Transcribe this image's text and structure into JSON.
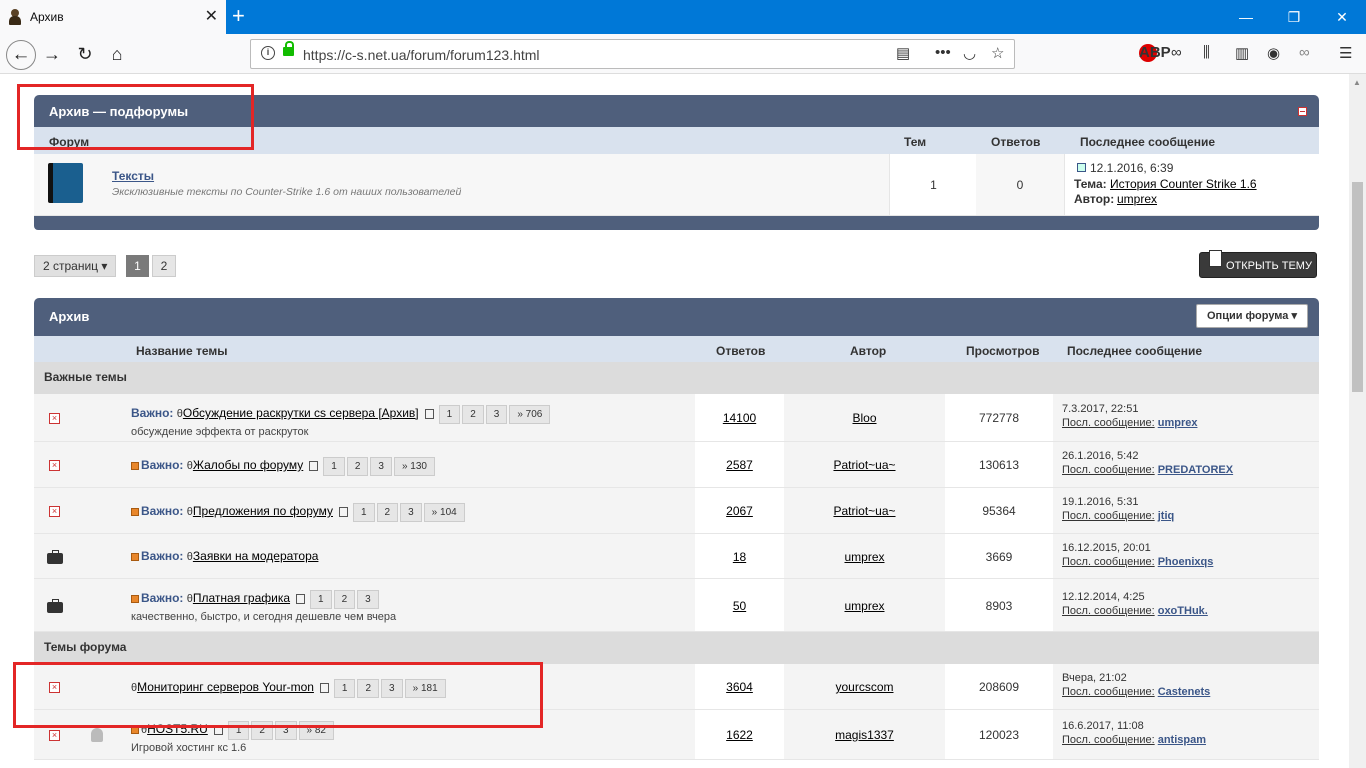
{
  "browser": {
    "tab_title": "Архив",
    "url": "https://c-s.net.ua/forum/forum123.html"
  },
  "subforums": {
    "title": "Архив — подфорумы",
    "headers": {
      "forum": "Форум",
      "topics": "Тем",
      "replies": "Ответов",
      "last": "Последнее сообщение"
    },
    "row": {
      "name": "Тексты",
      "desc": "Эксклюзивные тексты по Counter-Strike 1.6 от наших пользователей",
      "topics": "1",
      "replies": "0",
      "last_date": "12.1.2016, 6:39",
      "topic_label": "Тема:",
      "topic_link": "История Counter Strike 1.6",
      "author_label": "Автор:",
      "author_link": "umprex"
    }
  },
  "pagination": {
    "pages_label": "2 страниц",
    "p1": "1",
    "p2": "2"
  },
  "open_topic_label": "ОТКРЫТЬ ТЕМУ",
  "archive": {
    "title": "Архив",
    "options_label": "Опции форума",
    "headers": {
      "name": "Название темы",
      "replies": "Ответов",
      "author": "Автор",
      "views": "Просмотров",
      "last": "Последнее сообщение"
    },
    "section_important": "Важные темы",
    "section_forum": "Темы форума",
    "imp_label": "Важно:",
    "last_label": "Посл. сообщение:",
    "rows": [
      {
        "title": "Обсуждение раскрутки cs сервера [Архив]",
        "desc": "обсуждение эффекта от раскруток",
        "pages": [
          "1",
          "2",
          "3",
          "» 706"
        ],
        "replies": "14100",
        "author": "Bloo",
        "views": "772778",
        "date": "7.3.2017, 22:51",
        "last_user": "umprex"
      },
      {
        "title": "Жалобы по форуму",
        "desc": "",
        "pages": [
          "1",
          "2",
          "3",
          "» 130"
        ],
        "replies": "2587",
        "author": "Patriot~ua~",
        "views": "130613",
        "date": "26.1.2016, 5:42",
        "last_user": "PREDATOREX"
      },
      {
        "title": "Предложения по форуму",
        "desc": "",
        "pages": [
          "1",
          "2",
          "3",
          "» 104"
        ],
        "replies": "2067",
        "author": "Patriot~ua~",
        "views": "95364",
        "date": "19.1.2016, 5:31",
        "last_user": "jtiq"
      },
      {
        "title": "Заявки на модератора",
        "desc": "",
        "pages": [],
        "replies": "18",
        "author": "umprex",
        "views": "3669",
        "date": "16.12.2015, 20:01",
        "last_user": "Phoenixqs"
      },
      {
        "title": "Платная графика",
        "desc": "качественно, быстро, и сегодня дешевле чем вчера",
        "pages": [
          "1",
          "2",
          "3"
        ],
        "replies": "50",
        "author": "umprex",
        "views": "8903",
        "date": "12.12.2014, 4:25",
        "last_user": "oxoTHuk."
      },
      {
        "title": "Мониторинг серверов Your-mon",
        "desc": "",
        "pages": [
          "1",
          "2",
          "3",
          "» 181"
        ],
        "replies": "3604",
        "author": "yourcscom",
        "views": "208609",
        "date": "Вчера, 21:02",
        "last_user": "Castenets"
      },
      {
        "title": "HOST5.RU",
        "desc": "Игровой хостинг кс 1.6",
        "pages": [
          "1",
          "2",
          "3",
          "» 82"
        ],
        "replies": "1622",
        "author": "magis1337",
        "views": "120023",
        "date": "16.6.2017, 11:08",
        "last_user": "antispam"
      }
    ]
  }
}
